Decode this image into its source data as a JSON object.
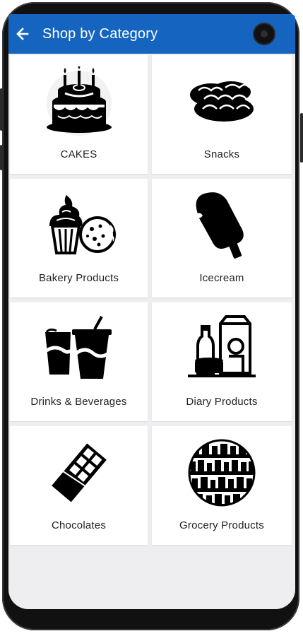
{
  "header": {
    "title": "Shop by Category"
  },
  "categories": [
    {
      "label": "CAKES",
      "icon": "cake-icon"
    },
    {
      "label": "Snacks",
      "icon": "bread-icon"
    },
    {
      "label": "Bakery Products",
      "icon": "cupcake-cookie-icon"
    },
    {
      "label": "Icecream",
      "icon": "ice-cream-bar-icon"
    },
    {
      "label": "Drinks & Beverages",
      "icon": "drinks-icon"
    },
    {
      "label": "Diary Products",
      "icon": "dairy-icon"
    },
    {
      "label": "Chocolates",
      "icon": "chocolate-bar-icon"
    },
    {
      "label": "Grocery Products",
      "icon": "grocery-shelf-icon"
    }
  ],
  "colors": {
    "appbar": "#1565c0",
    "background": "#eeeef0",
    "card": "#ffffff"
  }
}
